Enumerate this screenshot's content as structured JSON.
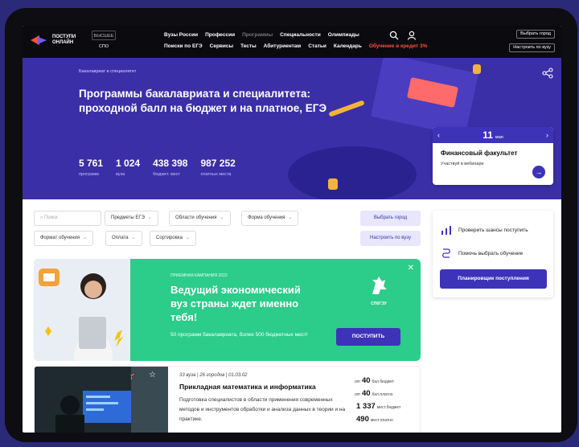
{
  "header": {
    "logo_text": "ПОСТУПИ ОНЛАЙН",
    "level_active": "ВЫСШЕЕ",
    "level_other": "СПО",
    "nav_row1": [
      "Вузы России",
      "Профессии",
      "Программы",
      "Специальности",
      "Олимпиады"
    ],
    "nav_row2": [
      "Поиски по ЕГЭ",
      "Сервисы",
      "Тесты",
      "Абитуриентам",
      "Статьи",
      "Календарь",
      "Обучение в кредит 3%"
    ],
    "choose_city": "Выбрать город",
    "settings": "Настроить по вузу"
  },
  "hero": {
    "breadcrumb": "Бакалавриат и специалитет",
    "title": "Программы бакалавриата и специалитета: проходной балл на бюджет и на платное, ЕГЭ",
    "stats": [
      {
        "value": "5 761",
        "label": "программ"
      },
      {
        "value": "1 024",
        "label": "вуза"
      },
      {
        "value": "438 398",
        "label": "бюджет. мест"
      },
      {
        "value": "987 252",
        "label": "платных места"
      }
    ],
    "event": {
      "day": "11",
      "month": "мая",
      "title": "Финансовый факультет",
      "subtitle": "Участвуй в вебинаре"
    }
  },
  "filters": {
    "search_placeholder": "Поиск",
    "ege": "Предметы ЕГЭ",
    "area": "Области обучения",
    "form": "Форма обучения",
    "format": "Формат обучения",
    "payment": "Оплата",
    "sort": "Сортировка",
    "choose_city": "Выбрать город",
    "setup_uni": "Настроить по вузу"
  },
  "promo": {
    "kicker": "ПРИЕМНАЯ КАМПАНИЯ 2023",
    "title": "Ведущий экономический вуз страны ждет именно тебя!",
    "text": "50 программ бакалавриата, более 500 бюджетных мест!",
    "button": "ПОСТУПИТЬ",
    "logo_name": "СПбГЭУ"
  },
  "panel": {
    "check_chances": "Проверить шансы поступить",
    "help_choose": "Помочь выбрать обучение",
    "planner": "Планировщик поступления"
  },
  "program": {
    "meta": "33 вуза | 26 городов | 01.03.02",
    "title": "Прикладная математика и информатика",
    "description": "Подготовка специалистов в области применения современных методов и инструментов обработки и анализа данных в теории и на практике.",
    "stats": [
      {
        "pre": "от",
        "value": "40",
        "post": "бал.бюджет"
      },
      {
        "pre": "от",
        "value": "40",
        "post": "бал.платно"
      },
      {
        "pre": "",
        "value": "1 337",
        "post": "мест.бюджет"
      },
      {
        "pre": "",
        "value": "490",
        "post": "мест.платно"
      }
    ]
  },
  "colors": {
    "brand_purple": "#3d33b8",
    "hero_bg": "#3b2fa7",
    "promo_green": "#2ccc8a",
    "hot_link": "#ff4f3d"
  }
}
